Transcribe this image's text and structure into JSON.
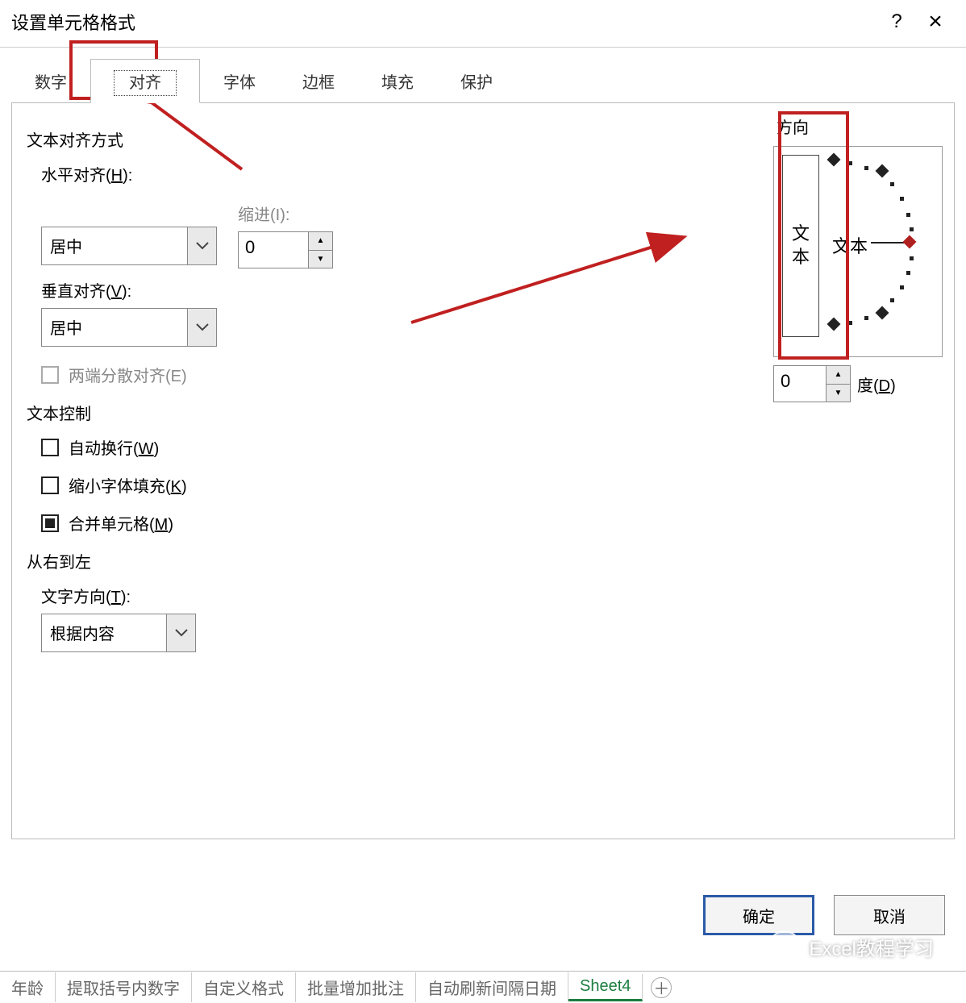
{
  "dialog": {
    "title": "设置单元格格式",
    "help_icon": "?",
    "close_icon": "×"
  },
  "tabs": {
    "number": "数字",
    "alignment": "对齐",
    "font": "字体",
    "border": "边框",
    "fill": "填充",
    "protection": "保护"
  },
  "alignment": {
    "text_align_title": "文本对齐方式",
    "horizontal_label_prefix": "水平对齐(",
    "horizontal_hotkey": "H",
    "horizontal_label_suffix": "):",
    "horizontal_value": "居中",
    "indent_label": "缩进(I):",
    "indent_value": "0",
    "vertical_label_prefix": "垂直对齐(",
    "vertical_hotkey": "V",
    "vertical_label_suffix": "):",
    "vertical_value": "居中",
    "justify_distributed": "两端分散对齐(E)"
  },
  "text_control": {
    "title": "文本控制",
    "wrap_prefix": "自动换行(",
    "wrap_hotkey": "W",
    "wrap_suffix": ")",
    "shrink_prefix": "缩小字体填充(",
    "shrink_hotkey": "K",
    "shrink_suffix": ")",
    "merge_prefix": "合并单元格(",
    "merge_hotkey": "M",
    "merge_suffix": ")"
  },
  "rtl": {
    "title": "从右到左",
    "direction_label_prefix": "文字方向(",
    "direction_hotkey": "T",
    "direction_label_suffix": "):",
    "direction_value": "根据内容"
  },
  "orientation": {
    "title": "方向",
    "vertical_text": "文本",
    "dial_text": "文本",
    "degrees_value": "0",
    "degrees_label_prefix": "度(",
    "degrees_hotkey": "D",
    "degrees_label_suffix": ")"
  },
  "buttons": {
    "ok": "确定",
    "cancel": "取消"
  },
  "sheet_tabs": {
    "t1": "年龄",
    "t2": "提取括号内数字",
    "t3": "自定义格式",
    "t4": "批量增加批注",
    "t5": "自动刷新间隔日期",
    "t6": "Sheet4",
    "plus": "＋"
  },
  "watermark": "Excel教程学习"
}
